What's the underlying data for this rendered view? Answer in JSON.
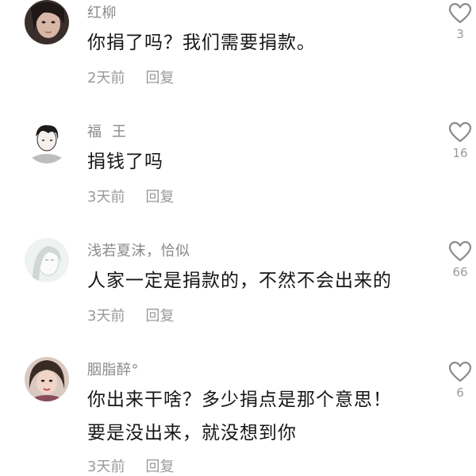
{
  "comments": [
    {
      "username": "红柳",
      "text_lines": [
        "你捐了吗？我们需要捐款。"
      ],
      "time": "2天前",
      "reply_label": "回复",
      "likes": "3"
    },
    {
      "username": "福  王",
      "text_lines": [
        "捐钱了吗"
      ],
      "time": "3天前",
      "reply_label": "回复",
      "likes": "16"
    },
    {
      "username": "浅若夏沫，恰似",
      "text_lines": [
        "人家一定是捐款的，不然不会出来的"
      ],
      "time": "3天前",
      "reply_label": "回复",
      "likes": "66"
    },
    {
      "username": "胭脂醉°",
      "text_lines": [
        "你出来干啥？多少捐点是那个意思！",
        "要是没出来，就没想到你"
      ],
      "time": "3天前",
      "reply_label": "回复",
      "likes": "6"
    }
  ],
  "icons": {
    "like": "heart-outline-icon"
  },
  "colors": {
    "secondary_text": "#9a9a9a",
    "primary_text": "#161616"
  }
}
